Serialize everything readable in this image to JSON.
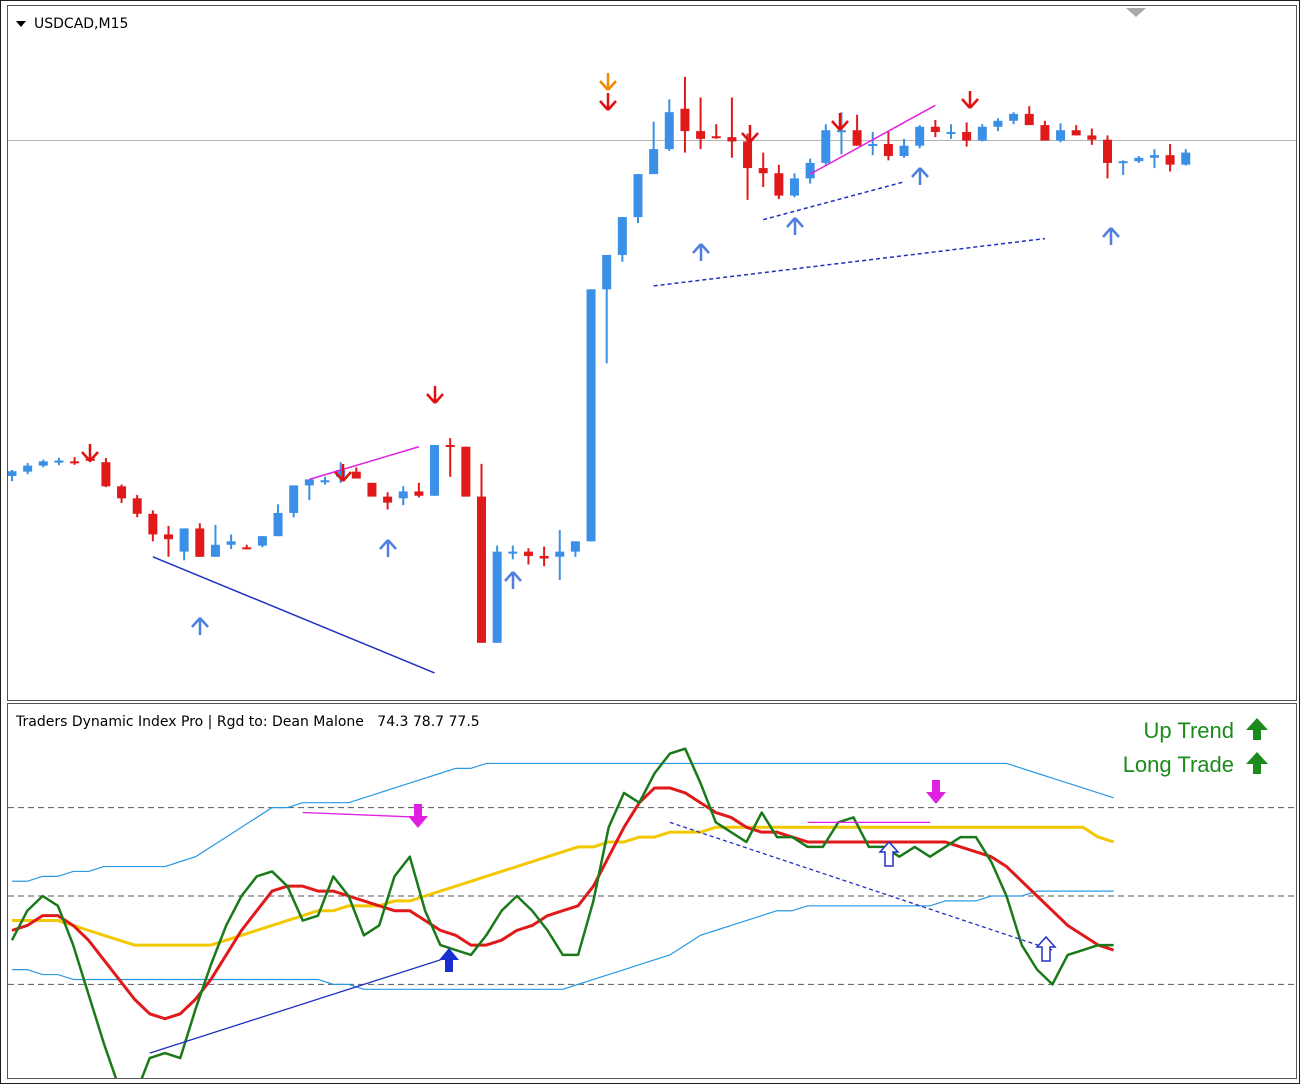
{
  "chart_title": "USDCAD,M15",
  "indicator": {
    "title": "Traders Dynamic Index Pro | Rgd to: Dean Malone",
    "values": "74.3 78.7 77.5",
    "labels": [
      "Up Trend",
      "Long Trade"
    ]
  },
  "colors": {
    "bull": "#3a8fe6",
    "bear": "#e01a1a",
    "rsi": "#1a7a1a",
    "signal": "#e01a1a",
    "baseline": "#f2c800",
    "bands": "#2a98e0",
    "divergence_bull": "#2030c0",
    "divergence_bear": "#e020e0",
    "arrow_up": "#4f7fe0",
    "arrow_down": "#e01010",
    "arrow_warn": "#f08a00"
  },
  "chart_data": {
    "type": "candlestick",
    "symbol": "USDCAD",
    "timeframe": "M15",
    "candles": [
      {
        "o": 1.4,
        "h": 2.1,
        "l": 0.8,
        "c": 1.95
      },
      {
        "o": 1.9,
        "h": 2.9,
        "l": 1.6,
        "c": 2.6
      },
      {
        "o": 2.6,
        "h": 3.3,
        "l": 2.4,
        "c": 3.1
      },
      {
        "o": 2.95,
        "h": 3.5,
        "l": 2.65,
        "c": 3.2
      },
      {
        "o": 3.1,
        "h": 3.6,
        "l": 2.7,
        "c": 3.0
      },
      {
        "o": 3.4,
        "h": 3.9,
        "l": 3.0,
        "c": 3.2
      },
      {
        "o": 3.0,
        "h": 3.5,
        "l": 0.1,
        "c": 0.2
      },
      {
        "o": 0.2,
        "h": 0.4,
        "l": -1.75,
        "c": -1.2
      },
      {
        "o": -1.2,
        "h": -0.8,
        "l": -3.4,
        "c": -3.0
      },
      {
        "o": -3.0,
        "h": -2.6,
        "l": -6.2,
        "c": -5.4
      },
      {
        "o": -5.4,
        "h": -4.4,
        "l": -8.0,
        "c": -5.95
      },
      {
        "o": -7.4,
        "h": -5.6,
        "l": -8.4,
        "c": -4.7
      },
      {
        "o": -4.7,
        "h": -4.1,
        "l": -8.0,
        "c": -8.0
      },
      {
        "o": -8.0,
        "h": -4.3,
        "l": -8.0,
        "c": -6.6
      },
      {
        "o": -6.6,
        "h": -5.4,
        "l": -7.1,
        "c": -6.2
      },
      {
        "o": -6.9,
        "h": -6.6,
        "l": -7.1,
        "c": -7.0
      },
      {
        "o": -6.7,
        "h": -5.8,
        "l": -6.9,
        "c": -5.6
      },
      {
        "o": -5.6,
        "h": -1.9,
        "l": -5.6,
        "c": -2.9
      },
      {
        "o": -2.9,
        "h": -2.0,
        "l": -3.4,
        "c": 0.3
      },
      {
        "o": 0.3,
        "h": 0.9,
        "l": -1.4,
        "c": 1.0
      },
      {
        "o": 0.7,
        "h": 1.3,
        "l": 0.4,
        "c": 0.9
      },
      {
        "o": 1.3,
        "h": 3.0,
        "l": 0.6,
        "c": 2.1
      },
      {
        "o": 1.9,
        "h": 2.4,
        "l": 1.1,
        "c": 1.1
      },
      {
        "o": 0.6,
        "h": 0.1,
        "l": -1.0,
        "c": -1.0
      },
      {
        "o": -1.0,
        "h": -0.5,
        "l": -2.5,
        "c": -1.7
      },
      {
        "o": -1.2,
        "h": 0.2,
        "l": -2.0,
        "c": -0.4
      },
      {
        "o": -0.4,
        "h": 0.6,
        "l": -1.1,
        "c": -0.9
      },
      {
        "o": -0.9,
        "h": 5.0,
        "l": -0.9,
        "c": 5.0
      },
      {
        "o": 5.0,
        "h": 5.8,
        "l": 1.3,
        "c": 4.8
      },
      {
        "o": 4.8,
        "h": 1.8,
        "l": -1.0,
        "c": -1.0
      },
      {
        "o": -1.0,
        "h": 2.8,
        "l": -18.0,
        "c": -18.0
      },
      {
        "o": -18.0,
        "h": -6.7,
        "l": -18.0,
        "c": -7.4
      },
      {
        "o": -7.4,
        "h": -6.7,
        "l": -8.3,
        "c": -7.4
      },
      {
        "o": -7.4,
        "h": -7.0,
        "l": -8.9,
        "c": -7.9
      },
      {
        "o": -7.9,
        "h": -6.8,
        "l": -9.1,
        "c": -8.2
      },
      {
        "o": -8.0,
        "h": -4.9,
        "l": -10.7,
        "c": -7.4
      },
      {
        "o": -7.4,
        "h": -7.0,
        "l": -8.0,
        "c": -6.2
      },
      {
        "o": -6.2,
        "h": 21.0,
        "l": -6.2,
        "c": 23.1
      },
      {
        "o": 23.1,
        "h": 20.0,
        "l": 14.5,
        "c": 27.1
      },
      {
        "o": 27.1,
        "h": 31.3,
        "l": 26.3,
        "c": 31.5
      },
      {
        "o": 31.5,
        "h": 33.7,
        "l": 30.8,
        "c": 36.5
      },
      {
        "o": 36.5,
        "h": 42.6,
        "l": 36.5,
        "c": 39.4
      },
      {
        "o": 39.4,
        "h": 45.2,
        "l": 39.2,
        "c": 43.7
      },
      {
        "o": 44.1,
        "h": 47.8,
        "l": 39.0,
        "c": 41.5
      },
      {
        "o": 41.5,
        "h": 45.4,
        "l": 39.4,
        "c": 40.6
      },
      {
        "o": 40.9,
        "h": 42.3,
        "l": 40.6,
        "c": 40.8
      },
      {
        "o": 40.8,
        "h": 45.4,
        "l": 38.4,
        "c": 40.3
      },
      {
        "o": 40.3,
        "h": 41.2,
        "l": 33.5,
        "c": 37.2
      },
      {
        "o": 37.2,
        "h": 39.0,
        "l": 35.0,
        "c": 36.6
      },
      {
        "o": 36.6,
        "h": 37.6,
        "l": 33.6,
        "c": 34.0
      },
      {
        "o": 34.0,
        "h": 36.6,
        "l": 33.8,
        "c": 36.0
      },
      {
        "o": 36.0,
        "h": 38.3,
        "l": 35.4,
        "c": 37.8
      },
      {
        "o": 37.8,
        "h": 42.3,
        "l": 37.6,
        "c": 41.6
      },
      {
        "o": 41.6,
        "h": 43.7,
        "l": 38.8,
        "c": 41.6
      },
      {
        "o": 41.6,
        "h": 43.4,
        "l": 40.2,
        "c": 39.8
      },
      {
        "o": 39.8,
        "h": 41.4,
        "l": 38.7,
        "c": 40.0
      },
      {
        "o": 40.0,
        "h": 41.4,
        "l": 38.1,
        "c": 38.6
      },
      {
        "o": 38.6,
        "h": 40.6,
        "l": 38.4,
        "c": 39.8
      },
      {
        "o": 39.8,
        "h": 42.2,
        "l": 39.5,
        "c": 42.0
      },
      {
        "o": 42.0,
        "h": 42.8,
        "l": 40.8,
        "c": 41.4
      },
      {
        "o": 41.4,
        "h": 42.3,
        "l": 40.6,
        "c": 41.4
      },
      {
        "o": 41.4,
        "h": 42.5,
        "l": 39.7,
        "c": 40.4
      },
      {
        "o": 40.4,
        "h": 42.3,
        "l": 40.3,
        "c": 42.0
      },
      {
        "o": 42.0,
        "h": 43.0,
        "l": 41.5,
        "c": 42.7
      },
      {
        "o": 42.7,
        "h": 43.7,
        "l": 42.3,
        "c": 43.5
      },
      {
        "o": 43.5,
        "h": 44.4,
        "l": 42.6,
        "c": 42.2
      },
      {
        "o": 42.2,
        "h": 42.7,
        "l": 40.5,
        "c": 40.4
      },
      {
        "o": 40.4,
        "h": 42.4,
        "l": 40.2,
        "c": 41.6
      },
      {
        "o": 41.6,
        "h": 42.2,
        "l": 41.0,
        "c": 41.0
      },
      {
        "o": 41.0,
        "h": 41.8,
        "l": 39.9,
        "c": 40.5
      },
      {
        "o": 40.5,
        "h": 41.0,
        "l": 36.0,
        "c": 37.8
      },
      {
        "o": 37.8,
        "h": 38.1,
        "l": 36.4,
        "c": 38.0
      },
      {
        "o": 38.0,
        "h": 38.6,
        "l": 37.8,
        "c": 38.4
      },
      {
        "o": 38.4,
        "h": 39.4,
        "l": 37.2,
        "c": 38.7
      },
      {
        "o": 38.7,
        "h": 40.0,
        "l": 36.8,
        "c": 37.6
      },
      {
        "o": 37.6,
        "h": 39.4,
        "l": 37.5,
        "c": 39.0
      }
    ],
    "horizontal_line": 40.4,
    "tdi": {
      "levels": [
        68,
        50,
        32
      ],
      "rsi_price_line": [
        41,
        47,
        50,
        48,
        40,
        30,
        20,
        11,
        9,
        17,
        18,
        17,
        27,
        36,
        44,
        50,
        54,
        55,
        52,
        45,
        46,
        54,
        50,
        42,
        44,
        54,
        58,
        47,
        40,
        39,
        38,
        42,
        47,
        50,
        47,
        43,
        38,
        38,
        49,
        64,
        71,
        69,
        75,
        79,
        80,
        73,
        65,
        63,
        61,
        67,
        62,
        62,
        60,
        60,
        65,
        66,
        60,
        60,
        58,
        60,
        58,
        60,
        62,
        62,
        57,
        50,
        40,
        35,
        32,
        38,
        39,
        40,
        40
      ],
      "signal_line": [
        43,
        44,
        46,
        46,
        44,
        41,
        37,
        33,
        29,
        26,
        25,
        26,
        29,
        33,
        38,
        43,
        47,
        51,
        52,
        52,
        51,
        51,
        50,
        49,
        48,
        47,
        47,
        45,
        43,
        42,
        40,
        40,
        41,
        43,
        44,
        46,
        47,
        48,
        52,
        58,
        64,
        69,
        72,
        72,
        71,
        69,
        67,
        66,
        64,
        63,
        63,
        62,
        61,
        61,
        61,
        61,
        61,
        61,
        61,
        61,
        61,
        61,
        60,
        59,
        58,
        56,
        53,
        50,
        47,
        44,
        42,
        40,
        39
      ],
      "market_base_line": [
        45,
        45,
        45,
        45,
        44,
        43,
        42,
        41,
        40,
        40,
        40,
        40,
        40,
        40,
        41,
        42,
        43,
        44,
        45,
        46,
        47,
        47,
        48,
        48,
        48,
        49,
        49,
        50,
        51,
        52,
        53,
        54,
        55,
        56,
        57,
        58,
        59,
        60,
        60,
        61,
        61,
        62,
        62,
        63,
        63,
        63,
        64,
        64,
        64,
        64,
        64,
        64,
        64,
        64,
        64,
        64,
        64,
        64,
        64,
        64,
        64,
        64,
        64,
        64,
        64,
        64,
        64,
        64,
        64,
        64,
        64,
        62,
        61
      ],
      "upper_band": [
        53,
        53,
        54,
        54,
        55,
        55,
        56,
        56,
        56,
        56,
        56,
        57,
        58,
        60,
        62,
        64,
        66,
        68,
        68,
        69,
        69,
        69,
        69,
        70,
        71,
        72,
        73,
        74,
        75,
        76,
        76,
        77,
        77,
        77,
        77,
        77,
        77,
        77,
        77,
        77,
        77,
        77,
        77,
        77,
        77,
        77,
        77,
        77,
        77,
        77,
        77,
        77,
        77,
        77,
        77,
        77,
        77,
        77,
        77,
        77,
        77,
        77,
        77,
        77,
        77,
        77,
        76,
        75,
        74,
        73,
        72,
        71,
        70
      ],
      "lower_band": [
        35,
        35,
        34,
        34,
        33,
        33,
        33,
        33,
        33,
        33,
        33,
        33,
        33,
        33,
        33,
        33,
        33,
        33,
        33,
        33,
        33,
        32,
        32,
        31,
        31,
        31,
        31,
        31,
        31,
        31,
        31,
        31,
        31,
        31,
        31,
        31,
        31,
        32,
        33,
        34,
        35,
        36,
        37,
        38,
        40,
        42,
        43,
        44,
        45,
        46,
        47,
        47,
        48,
        48,
        48,
        48,
        48,
        48,
        48,
        48,
        48,
        49,
        49,
        49,
        50,
        50,
        50,
        51,
        51,
        51,
        51,
        51,
        51
      ]
    }
  }
}
